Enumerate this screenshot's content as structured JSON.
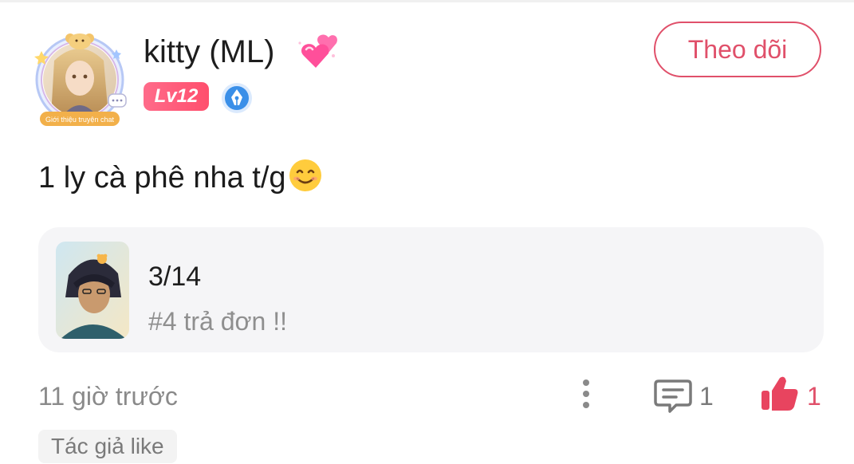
{
  "user": {
    "name": "kitty (ML)",
    "level": "Lv12",
    "avatar_frame_caption": "Giới thiệu truyện chat"
  },
  "follow_button": {
    "label": "Theo dõi"
  },
  "comment": {
    "text": "1 ly cà phê nha t/g"
  },
  "chapter_card": {
    "title": "3/14",
    "subtitle": "#4 trả đơn !!"
  },
  "footer": {
    "timestamp": "11 giờ trước",
    "reply_count": "1",
    "like_count": "1",
    "author_tag": "Tác giả like"
  },
  "colors": {
    "accent": "#e0506a",
    "level_badge": "#ff5a78",
    "writer_badge": "#3a8fe8",
    "card_bg": "#f5f5f7",
    "muted_text": "#8a8a8a"
  },
  "icons": {
    "avatar": "avatar-with-bear-frame",
    "hearts": "two-hearts-icon",
    "writer_badge": "pen-nib-badge-icon",
    "emoji": "smiling-face-icon",
    "more": "vertical-dots-icon",
    "comment": "comment-bubble-icon",
    "like": "thumbs-up-icon"
  }
}
